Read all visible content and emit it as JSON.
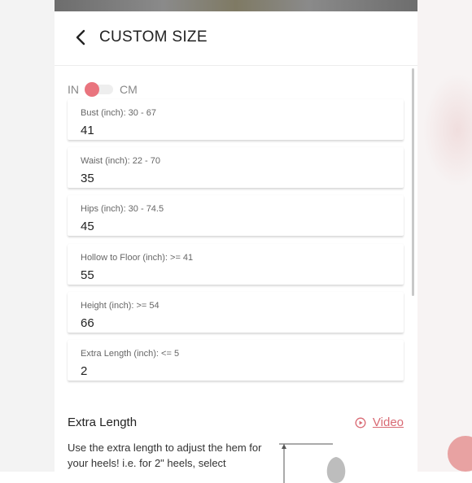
{
  "header": {
    "title": "CUSTOM SIZE"
  },
  "units": {
    "left": "IN",
    "right": "CM",
    "selected": "IN"
  },
  "fields": [
    {
      "label": "Bust (inch): 30 - 67",
      "value": "41"
    },
    {
      "label": "Waist (inch): 22 - 70",
      "value": "35"
    },
    {
      "label": "Hips (inch): 30 - 74.5",
      "value": "45"
    },
    {
      "label": "Hollow to Floor (inch): >= 41",
      "value": "55"
    },
    {
      "label": "Height (inch): >= 54",
      "value": "66"
    },
    {
      "label": "Extra Length (inch): <= 5",
      "value": "2"
    }
  ],
  "extra_length": {
    "title": "Extra Length",
    "video_label": "Video",
    "description": "Use the extra length to adjust the hem for your heels! i.e. for 2\" heels, select"
  },
  "colors": {
    "accent": "#e9747e",
    "link": "#d96a74"
  }
}
